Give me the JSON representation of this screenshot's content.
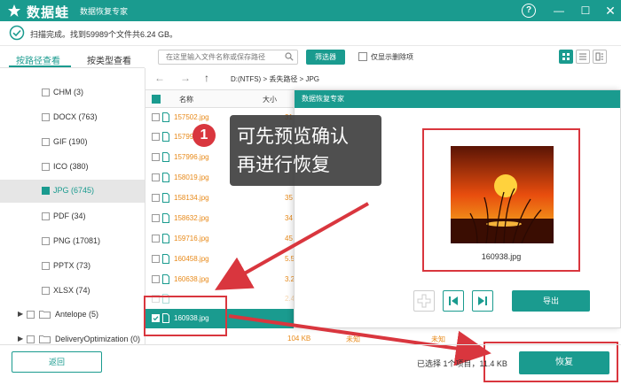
{
  "app": {
    "logo_text": "数据蛙",
    "subtitle": "数据恢复专家",
    "window_controls": {
      "help": "?",
      "min": "—",
      "max": "☐",
      "close": "✕"
    }
  },
  "status": {
    "text": "扫描完成。找到59989个文件共6.24 GB。"
  },
  "tabs": {
    "by_path": "按路径查看",
    "by_type": "按类型查看"
  },
  "search": {
    "placeholder": "在这里输入文件名称或保存路径",
    "filter_label": "筛选器",
    "deleted_only_label": "仅显示删除项"
  },
  "path": "D:(NTFS) > 丢失路径 > JPG",
  "nav": {
    "back": "←",
    "forward": "→",
    "up": "↑"
  },
  "tree": [
    {
      "label": "CHM (3)"
    },
    {
      "label": "DOCX (763)"
    },
    {
      "label": "GIF (190)"
    },
    {
      "label": "ICO (380)"
    },
    {
      "label": "JPG (6745)",
      "selected": true
    },
    {
      "label": "PDF (34)"
    },
    {
      "label": "PNG (17081)"
    },
    {
      "label": "PPTX (73)"
    },
    {
      "label": "XLSX (74)"
    }
  ],
  "tree_folders": [
    {
      "label": "Antelope (5)"
    },
    {
      "label": "DeliveryOptimization (0)"
    }
  ],
  "list": {
    "header_name": "名称",
    "header_size": "大小",
    "rows": [
      {
        "name": "157502.jpg",
        "size": "31"
      },
      {
        "name": "157996.jpg",
        "size": ""
      },
      {
        "name": "158019.jpg",
        "size": ""
      },
      {
        "name": "158134.jpg",
        "size": "35"
      },
      {
        "name": "158632.jpg",
        "size": "34"
      },
      {
        "name": "159716.jpg",
        "size": "45"
      },
      {
        "name": "160458.jpg",
        "size": "5.5"
      },
      {
        "name": "160638.jpg",
        "size": "3.2"
      },
      {
        "name": "160938.jpg",
        "size": "",
        "selected": true
      }
    ],
    "last_row": {
      "size": "104 KB",
      "c1": "未知",
      "c2": "未知"
    }
  },
  "preview": {
    "title": "数据恢复专家",
    "filename": "160938.jpg",
    "export_label": "导出"
  },
  "tip": {
    "badge": "1",
    "line1": "可先预览确认",
    "line2": "再进行恢复"
  },
  "footer": {
    "back_label": "返回",
    "selected_info": "已选择 1个项目，11.4 KB",
    "recover_label": "恢复"
  },
  "colors": {
    "accent": "#1a9b8f",
    "highlight": "#d9363e",
    "file_text": "#e88a1a"
  }
}
